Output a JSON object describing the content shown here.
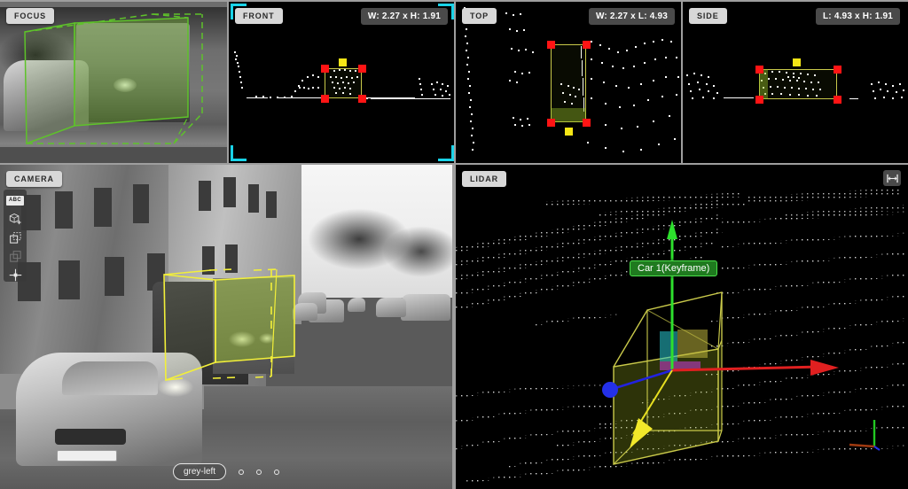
{
  "app": {
    "title": "3D Point Cloud Annotation Tool",
    "accent_selected": "#19d3e8",
    "box_color_focus": "#5ec22a",
    "box_color_camera": "#f2ef3a",
    "box_color_lidar": "#c9c94a",
    "handle_color": "#ff1414",
    "rotation_handle_color": "#f5e616"
  },
  "panels": {
    "focus": {
      "label": "FOCUS",
      "selected": false
    },
    "front": {
      "label": "FRONT",
      "dimensions": "W: 2.27 x H: 1.91",
      "selected": true
    },
    "top": {
      "label": "TOP",
      "dimensions": "W: 2.27 x L: 4.93",
      "selected": false
    },
    "side": {
      "label": "SIDE",
      "dimensions": "L: 4.93 x H: 1.91",
      "selected": false
    },
    "camera": {
      "label": "CAMERA",
      "toolbar": [
        {
          "name": "abc-label-toggle",
          "label": "ABC",
          "icon": "abc-icon"
        },
        {
          "name": "add-box-tool",
          "label": "",
          "icon": "cube-plus-icon"
        },
        {
          "name": "copy-box-tool",
          "label": "",
          "icon": "copy-icon"
        },
        {
          "name": "paste-box-tool",
          "label": "",
          "icon": "duplicate-icon"
        },
        {
          "name": "move-tool",
          "label": "",
          "icon": "crosshair-icon"
        }
      ],
      "footer": {
        "camera_name": "grey-left",
        "dot_count": 3
      }
    },
    "lidar": {
      "label": "LIDAR",
      "object_label": "Car 1(Keyframe)",
      "expand_icon": "fullscreen-icon"
    }
  },
  "object": {
    "class": "Car",
    "id": "1",
    "frame_type": "Keyframe",
    "width": "2.27",
    "length": "4.93",
    "height": "1.91"
  }
}
